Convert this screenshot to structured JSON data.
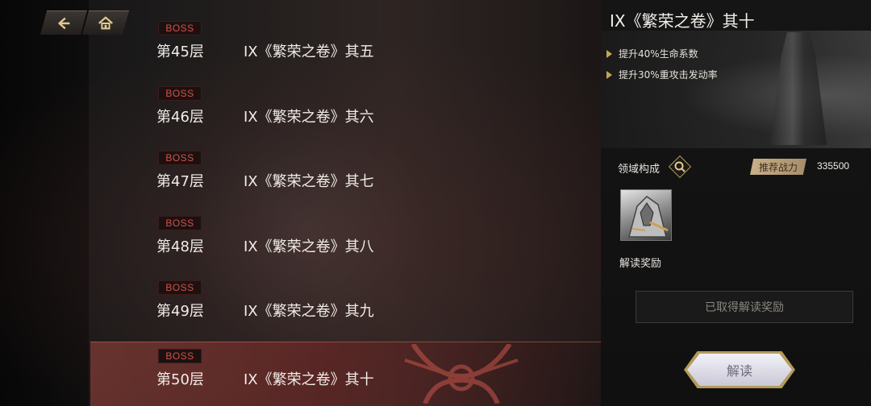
{
  "nav": {
    "back_icon": "back-arrow-icon",
    "home_icon": "home-icon"
  },
  "floors": [
    {
      "badge": "BOSS",
      "floor": "第45层",
      "title": "IX《繁荣之卷》其五",
      "selected": false
    },
    {
      "badge": "BOSS",
      "floor": "第46层",
      "title": "IX《繁荣之卷》其六",
      "selected": false
    },
    {
      "badge": "BOSS",
      "floor": "第47层",
      "title": "IX《繁荣之卷》其七",
      "selected": false
    },
    {
      "badge": "BOSS",
      "floor": "第48层",
      "title": "IX《繁荣之卷》其八",
      "selected": false
    },
    {
      "badge": "BOSS",
      "floor": "第49层",
      "title": "IX《繁荣之卷》其九",
      "selected": false
    },
    {
      "badge": "BOSS",
      "floor": "第50层",
      "title": "IX《繁荣之卷》其十",
      "selected": true
    }
  ],
  "detail": {
    "title": "IX《繁荣之卷》其十",
    "bonuses": [
      "提升40%生命系数",
      "提升30%重攻击发动率"
    ],
    "domain_label": "领域构成",
    "power_label": "推荐战力",
    "power_value": "335500",
    "reward_label": "解读奖励",
    "claimed_label": "已取得解读奖励",
    "read_button": "解读"
  },
  "colors": {
    "boss_text": "#d3524a",
    "accent_gold": "#b69a5e",
    "selected_row": "#8a3a34"
  }
}
